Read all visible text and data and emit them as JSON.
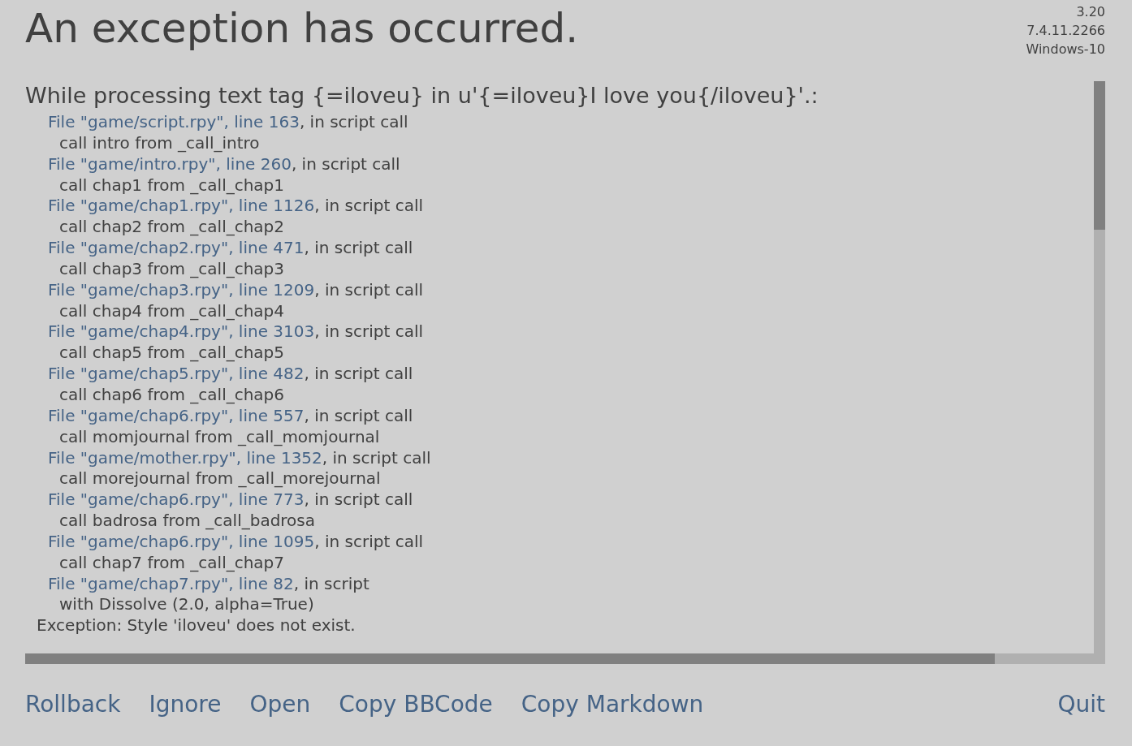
{
  "title": "An exception has occurred.",
  "version_info": [
    "3.20",
    "7.4.11.2266",
    "Windows-10"
  ],
  "heading": "While processing text tag {=iloveu} in u'{=iloveu}I love you{/iloveu}'.:",
  "traceback": [
    {
      "kind": "file",
      "link": "File \"game/script.rpy\", line 163",
      "rest": ", in script call"
    },
    {
      "kind": "code",
      "text": "call intro from _call_intro"
    },
    {
      "kind": "file",
      "link": "File \"game/intro.rpy\", line 260",
      "rest": ", in script call"
    },
    {
      "kind": "code",
      "text": "call chap1 from _call_chap1"
    },
    {
      "kind": "file",
      "link": "File \"game/chap1.rpy\", line 1126",
      "rest": ", in script call"
    },
    {
      "kind": "code",
      "text": "call chap2 from _call_chap2"
    },
    {
      "kind": "file",
      "link": "File \"game/chap2.rpy\", line 471",
      "rest": ", in script call"
    },
    {
      "kind": "code",
      "text": "call chap3 from _call_chap3"
    },
    {
      "kind": "file",
      "link": "File \"game/chap3.rpy\", line 1209",
      "rest": ", in script call"
    },
    {
      "kind": "code",
      "text": "call chap4 from _call_chap4"
    },
    {
      "kind": "file",
      "link": "File \"game/chap4.rpy\", line 3103",
      "rest": ", in script call"
    },
    {
      "kind": "code",
      "text": "call chap5 from _call_chap5"
    },
    {
      "kind": "file",
      "link": "File \"game/chap5.rpy\", line 482",
      "rest": ", in script call"
    },
    {
      "kind": "code",
      "text": "call chap6 from _call_chap6"
    },
    {
      "kind": "file",
      "link": "File \"game/chap6.rpy\", line 557",
      "rest": ", in script call"
    },
    {
      "kind": "code",
      "text": "call momjournal from _call_momjournal"
    },
    {
      "kind": "file",
      "link": "File \"game/mother.rpy\", line 1352",
      "rest": ", in script call"
    },
    {
      "kind": "code",
      "text": "call morejournal from _call_morejournal"
    },
    {
      "kind": "file",
      "link": "File \"game/chap6.rpy\", line 773",
      "rest": ", in script call"
    },
    {
      "kind": "code",
      "text": "call badrosa from _call_badrosa"
    },
    {
      "kind": "file",
      "link": "File \"game/chap6.rpy\", line 1095",
      "rest": ", in script call"
    },
    {
      "kind": "code",
      "text": "call chap7 from _call_chap7"
    },
    {
      "kind": "file",
      "link": "File \"game/chap7.rpy\", line 82",
      "rest": ", in script"
    },
    {
      "kind": "code",
      "text": "with Dissolve (2.0, alpha=True)"
    },
    {
      "kind": "exception",
      "text": "Exception: Style 'iloveu' does not exist."
    }
  ],
  "actions": [
    "Rollback",
    "Ignore",
    "Open",
    "Copy BBCode",
    "Copy Markdown"
  ],
  "quit": "Quit"
}
